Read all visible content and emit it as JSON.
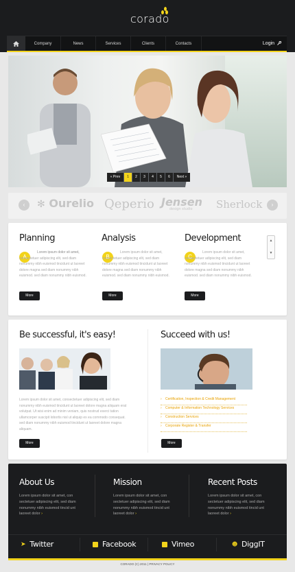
{
  "header": {
    "logo_text": "corado",
    "nav": {
      "home_icon": "home-icon",
      "items": [
        "Company",
        "News",
        "Services",
        "Clients",
        "Contacts"
      ],
      "login_label": "Login",
      "login_icon": "key-icon"
    }
  },
  "hero": {
    "pager": {
      "prev": "« Prev",
      "pages": [
        "1",
        "2",
        "3",
        "4",
        "5",
        "6"
      ],
      "active_page": "1",
      "next": "Next »"
    }
  },
  "brands": {
    "items": [
      "Ourelio",
      "Qeperio",
      "Jensen",
      "Sherlock"
    ],
    "jensen_subtitle": "design studio",
    "prev_icon": "chevron-left-icon",
    "next_icon": "chevron-right-icon"
  },
  "services": [
    {
      "title": "Planning",
      "badge": "A",
      "text": "Lorem ipsum dolor sit amet, consectetuer adipiscing elit, sed diam nonummy nibh euismod tincidunt ut laoreet dolore magna sed diam nonummy nibh euismod. sed diam nonummy nibh euismod.",
      "button": "More"
    },
    {
      "title": "Analysis",
      "badge": "B",
      "text": "Lorem ipsum dolor sit amet, consectetuer adipiscing elit, sed diam nonummy nibh euismod tincidunt ut laoreet dolore magna sed diam nonummy nibh euismod. sed diam nonummy nibh euismod.",
      "button": "More"
    },
    {
      "title": "Development",
      "badge": "C",
      "text": "Lorem ipsum dolor sit amet, consectetuer adipiscing elit, sed diam nonummy nibh euismod tincidunt ut laoreet dolore magna sed diam nonummy nibh euismod. sed diam nonummy nibh euismod.",
      "button": "More"
    }
  ],
  "left_column": {
    "title": "Be successful, it's easy!",
    "text": "Lorem ipsum dolor sit amet, consectetuer adipiscing elit, sed diam nonummy nibh euismod tincidunt ut laoreet dolore magna aliquam erat volutpat. Ut wisi enim ad minim veniam, quis nostrud exerci tation ullamcorper suscipit lobortis nisl ut aliquip ex ea commodo consequat. sed diam nonummy nibh euismod tincidunt ut laoreet dolore magna aliquam.",
    "button": "More"
  },
  "right_column": {
    "title": "Succeed with us!",
    "links": [
      "Certification, Inspection & Credit Management",
      "Computer & Information Technology Services",
      "Construction Services",
      "Corporate Register & Transfer"
    ],
    "button": "More"
  },
  "footer": {
    "about": {
      "title": "About Us",
      "text": "Lorem ipsum dolor sit amet, con sectetuer adipiscing elit, sed diam nonummy nibh euismod tincid unt laoreet dolor",
      "arrow": "›"
    },
    "mission": {
      "title": "Mission",
      "text": "Lorem ipsum dolor sit amet, con sectetuer adipiscing elit, sed diam nonummy nibh euismod tincid unt laoreet dolor",
      "arrow": "›"
    },
    "posts": {
      "title": "Recent Posts",
      "text": "Lorem ipsum dolor sit amet, con sectetuer adipiscing elit, sed diam nonummy nibh euismod tincid unt laoreet dolor",
      "arrow": "›"
    },
    "social": [
      {
        "label": "Twitter",
        "icon": "twitter-icon"
      },
      {
        "label": "Facebook",
        "icon": "facebook-icon"
      },
      {
        "label": "Vimeo",
        "icon": "vimeo-icon"
      },
      {
        "label": "DiggIT",
        "icon": "digg-icon"
      }
    ],
    "copyright": "CORADO (C) 2011 | PRIVACY POLICY"
  },
  "colors": {
    "accent": "#f2d31b",
    "dark": "#1b1c1e",
    "link": "#e8a100"
  }
}
